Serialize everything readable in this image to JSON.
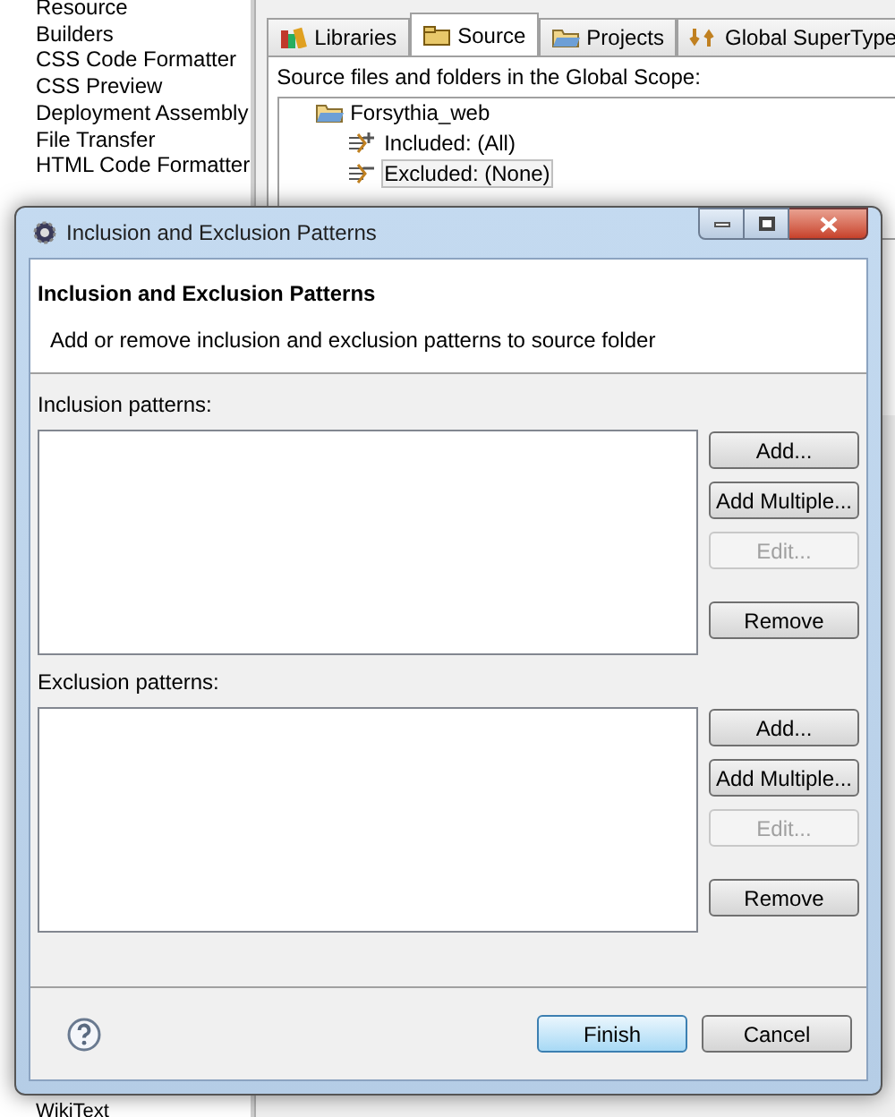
{
  "background": {
    "sidebar_items": [
      "Resource",
      "Builders",
      "CSS Code Formatter",
      "CSS Preview",
      "Deployment Assembly",
      "File Transfer",
      "HTML Code Formatter"
    ],
    "tabs": [
      {
        "label": "Libraries",
        "selected": false
      },
      {
        "label": "Source",
        "selected": true
      },
      {
        "label": "Projects",
        "selected": false
      },
      {
        "label": "Global SuperType",
        "selected": false
      }
    ],
    "scope_label": "Source files and folders in the Global Scope:",
    "tree": {
      "label": "Forsythia_web",
      "children": [
        {
          "label": "Included: (All)",
          "selected": false
        },
        {
          "label": "Excluded: (None)",
          "selected": true
        }
      ]
    },
    "footer_item": "WikiText"
  },
  "dialog": {
    "title": "Inclusion and Exclusion Patterns",
    "header_title": "Inclusion and Exclusion Patterns",
    "header_message": "Add or remove inclusion and exclusion patterns to source folder",
    "sections": [
      {
        "label": "Inclusion patterns:",
        "buttons": [
          {
            "label": "Add...",
            "disabled": false
          },
          {
            "label": "Add Multiple...",
            "disabled": false
          },
          {
            "label": "Edit...",
            "disabled": true
          },
          {
            "label": "Remove",
            "disabled": false
          }
        ]
      },
      {
        "label": "Exclusion patterns:",
        "buttons": [
          {
            "label": "Add...",
            "disabled": false
          },
          {
            "label": "Add Multiple...",
            "disabled": false
          },
          {
            "label": "Edit...",
            "disabled": true
          },
          {
            "label": "Remove",
            "disabled": false
          }
        ]
      }
    ],
    "buttons": [
      {
        "label": "Finish",
        "default": true
      },
      {
        "label": "Cancel",
        "default": false
      }
    ]
  }
}
